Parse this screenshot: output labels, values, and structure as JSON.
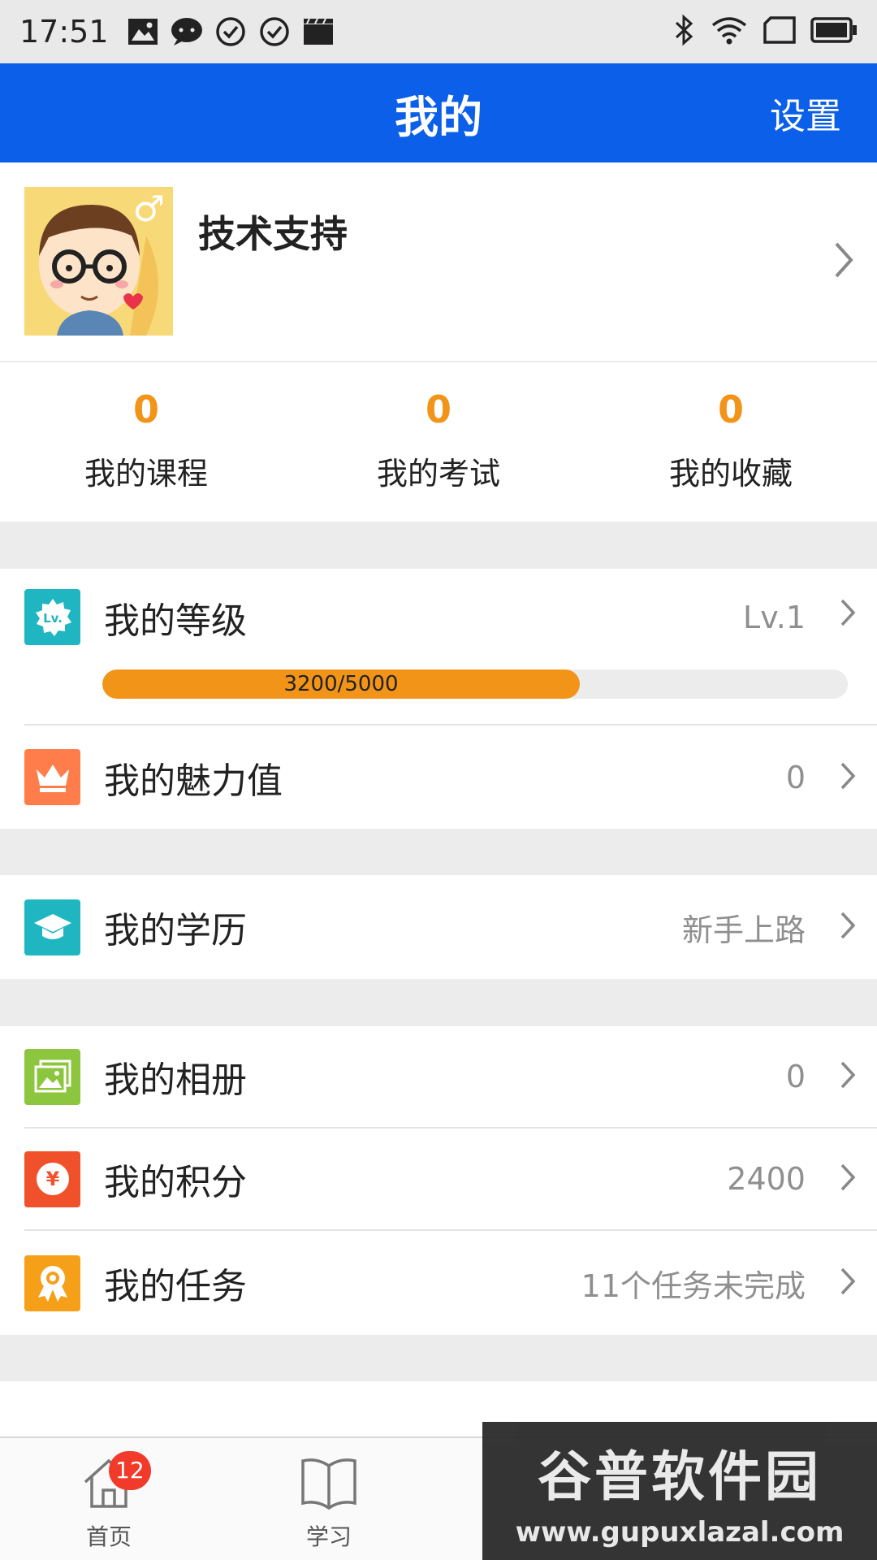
{
  "status_bar": {
    "time": "17:51",
    "left_icons": [
      "image-icon",
      "chat-bubble-icon",
      "check-circle-icon",
      "check-circle-icon",
      "clapperboard-icon"
    ],
    "right_icons": [
      "bluetooth-icon",
      "wifi-icon",
      "sim-icon",
      "battery-icon"
    ]
  },
  "header": {
    "title": "我的",
    "settings_label": "设置"
  },
  "profile": {
    "name": "技术支持",
    "avatar_icon": "avatar-cartoon-icon",
    "gender_symbol": "♂"
  },
  "stats": [
    {
      "value": "0",
      "label": "我的课程"
    },
    {
      "value": "0",
      "label": "我的考试"
    },
    {
      "value": "0",
      "label": "我的收藏"
    }
  ],
  "level": {
    "label": "我的等级",
    "value": "Lv.1",
    "progress_text": "3200/5000",
    "progress_current": 3200,
    "progress_max": 5000,
    "icon": "level-badge-icon",
    "icon_color": "#1fb6c2",
    "bar_color": "#f29418"
  },
  "charm": {
    "label": "我的魅力值",
    "value": "0",
    "icon": "crown-icon",
    "icon_color": "#ff7d4a"
  },
  "education": {
    "label": "我的学历",
    "value": "新手上路",
    "icon": "graduation-cap-icon",
    "icon_color": "#1fb6c2"
  },
  "album": {
    "label": "我的相册",
    "value": "0",
    "icon": "photo-album-icon",
    "icon_color": "#8cc63e"
  },
  "points": {
    "label": "我的积分",
    "value": "2400",
    "icon": "yuan-coin-icon",
    "icon_color": "#f0512a"
  },
  "tasks": {
    "label": "我的任务",
    "value": "11个任务未完成",
    "icon": "award-ribbon-icon",
    "icon_color": "#f5a018"
  },
  "tabbar": {
    "tabs": [
      {
        "label": "首页",
        "icon": "home-icon",
        "badge": "12"
      },
      {
        "label": "学习",
        "icon": "book-icon"
      }
    ]
  },
  "watermark": {
    "title": "谷普软件园",
    "url": "www.gupuxlazal.com"
  },
  "colors": {
    "header_bg": "#0b5fe8",
    "accent_orange": "#f29418",
    "page_bg": "#ececec"
  }
}
